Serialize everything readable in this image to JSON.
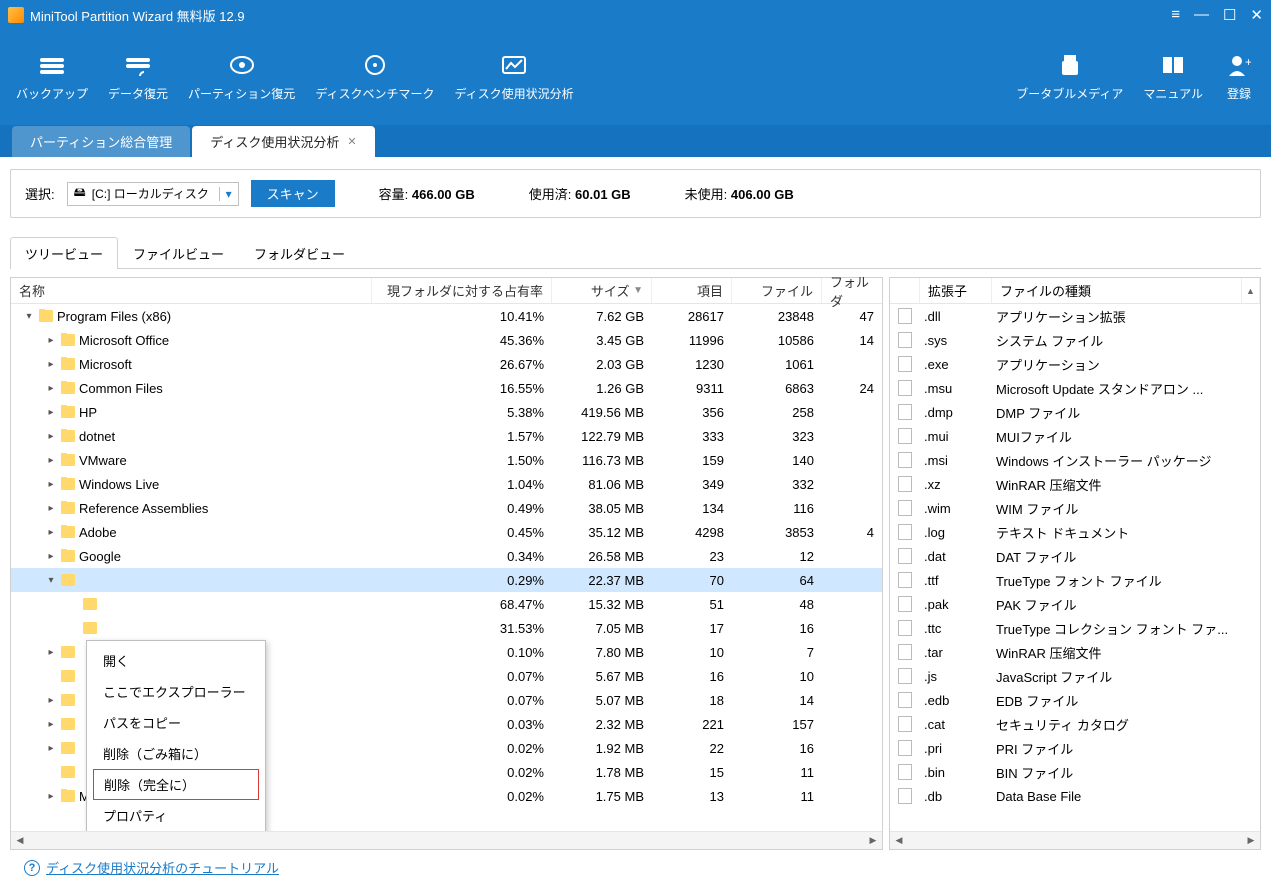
{
  "title": "MiniTool Partition Wizard 無料版 12.9",
  "ribbon": {
    "left": [
      {
        "label": "バックアップ"
      },
      {
        "label": "データ復元"
      },
      {
        "label": "パーティション復元"
      },
      {
        "label": "ディスクベンチマーク"
      },
      {
        "label": "ディスク使用状況分析"
      }
    ],
    "right": [
      {
        "label": "ブータブルメディア"
      },
      {
        "label": "マニュアル"
      },
      {
        "label": "登録"
      }
    ]
  },
  "main_tabs": {
    "inactive": "パーティション総合管理",
    "active": "ディスク使用状況分析"
  },
  "scan": {
    "select_label": "選択:",
    "drive": "[C:] ローカルディスク",
    "scan_btn": "スキャン",
    "cap_label": "容量:",
    "cap_value": "466.00 GB",
    "used_label": "使用済:",
    "used_value": "60.01 GB",
    "free_label": "未使用:",
    "free_value": "406.00 GB"
  },
  "view_tabs": [
    "ツリービュー",
    "ファイルビュー",
    "フォルダビュー"
  ],
  "tree_headers": {
    "name": "名称",
    "ratio": "現フォルダに対する占有率",
    "size": "サイズ",
    "items": "項目",
    "files": "ファイル",
    "folders": "フォルダ"
  },
  "tree_rows": [
    {
      "indent": 0,
      "arrow": "▾",
      "name": "Program Files (x86)",
      "ratio": "10.41%",
      "size": "7.62 GB",
      "items": "28617",
      "files": "23848",
      "folders": "47",
      "sel": false
    },
    {
      "indent": 1,
      "arrow": "▸",
      "name": "Microsoft Office",
      "ratio": "45.36%",
      "size": "3.45 GB",
      "items": "11996",
      "files": "10586",
      "folders": "14",
      "sel": false
    },
    {
      "indent": 1,
      "arrow": "▸",
      "name": "Microsoft",
      "ratio": "26.67%",
      "size": "2.03 GB",
      "items": "1230",
      "files": "1061",
      "folders": "",
      "sel": false
    },
    {
      "indent": 1,
      "arrow": "▸",
      "name": "Common Files",
      "ratio": "16.55%",
      "size": "1.26 GB",
      "items": "9311",
      "files": "6863",
      "folders": "24",
      "sel": false
    },
    {
      "indent": 1,
      "arrow": "▸",
      "name": "HP",
      "ratio": "5.38%",
      "size": "419.56 MB",
      "items": "356",
      "files": "258",
      "folders": "",
      "sel": false
    },
    {
      "indent": 1,
      "arrow": "▸",
      "name": "dotnet",
      "ratio": "1.57%",
      "size": "122.79 MB",
      "items": "333",
      "files": "323",
      "folders": "",
      "sel": false
    },
    {
      "indent": 1,
      "arrow": "▸",
      "name": "VMware",
      "ratio": "1.50%",
      "size": "116.73 MB",
      "items": "159",
      "files": "140",
      "folders": "",
      "sel": false
    },
    {
      "indent": 1,
      "arrow": "▸",
      "name": "Windows Live",
      "ratio": "1.04%",
      "size": "81.06 MB",
      "items": "349",
      "files": "332",
      "folders": "",
      "sel": false
    },
    {
      "indent": 1,
      "arrow": "▸",
      "name": "Reference Assemblies",
      "ratio": "0.49%",
      "size": "38.05 MB",
      "items": "134",
      "files": "116",
      "folders": "",
      "sel": false
    },
    {
      "indent": 1,
      "arrow": "▸",
      "name": "Adobe",
      "ratio": "0.45%",
      "size": "35.12 MB",
      "items": "4298",
      "files": "3853",
      "folders": "4",
      "sel": false
    },
    {
      "indent": 1,
      "arrow": "▸",
      "name": "Google",
      "ratio": "0.34%",
      "size": "26.58 MB",
      "items": "23",
      "files": "12",
      "folders": "",
      "sel": false
    },
    {
      "indent": 1,
      "arrow": "▾",
      "name": "",
      "ratio": "0.29%",
      "size": "22.37 MB",
      "items": "70",
      "files": "64",
      "folders": "",
      "sel": true
    },
    {
      "indent": 2,
      "arrow": "",
      "name": "",
      "ratio": "68.47%",
      "size": "15.32 MB",
      "items": "51",
      "files": "48",
      "folders": "",
      "sel": false
    },
    {
      "indent": 2,
      "arrow": "",
      "name": "",
      "ratio": "31.53%",
      "size": "7.05 MB",
      "items": "17",
      "files": "16",
      "folders": "",
      "sel": false
    },
    {
      "indent": 1,
      "arrow": "▸",
      "name": "",
      "ratio": "0.10%",
      "size": "7.80 MB",
      "items": "10",
      "files": "7",
      "folders": "",
      "sel": false
    },
    {
      "indent": 1,
      "arrow": "",
      "name": "",
      "ratio": "0.07%",
      "size": "5.67 MB",
      "items": "16",
      "files": "10",
      "folders": "",
      "sel": false
    },
    {
      "indent": 1,
      "arrow": "▸",
      "name": "",
      "ratio": "0.07%",
      "size": "5.07 MB",
      "items": "18",
      "files": "14",
      "folders": "",
      "sel": false
    },
    {
      "indent": 1,
      "arrow": "▸",
      "name": "",
      "ratio": "0.03%",
      "size": "2.32 MB",
      "items": "221",
      "files": "157",
      "folders": "",
      "sel": false
    },
    {
      "indent": 1,
      "arrow": "▸",
      "name": "",
      "ratio": "0.02%",
      "size": "1.92 MB",
      "items": "22",
      "files": "16",
      "folders": "",
      "sel": false
    },
    {
      "indent": 1,
      "arrow": "",
      "name": "",
      "ratio": "0.02%",
      "size": "1.78 MB",
      "items": "15",
      "files": "11",
      "folders": "",
      "sel": false
    },
    {
      "indent": 1,
      "arrow": "▸",
      "name": "Microsoft SQL Server Compa...",
      "ratio": "0.02%",
      "size": "1.75 MB",
      "items": "13",
      "files": "11",
      "folders": "",
      "sel": false
    }
  ],
  "ext_headers": {
    "ext": "拡張子",
    "type": "ファイルの種類"
  },
  "ext_rows": [
    {
      "ext": ".dll",
      "type": "アプリケーション拡張"
    },
    {
      "ext": ".sys",
      "type": "システム ファイル"
    },
    {
      "ext": ".exe",
      "type": "アプリケーション"
    },
    {
      "ext": ".msu",
      "type": "Microsoft Update スタンドアロン ..."
    },
    {
      "ext": ".dmp",
      "type": "DMP ファイル"
    },
    {
      "ext": ".mui",
      "type": "MUIファイル"
    },
    {
      "ext": ".msi",
      "type": "Windows インストーラー パッケージ"
    },
    {
      "ext": ".xz",
      "type": "WinRAR 压缩文件"
    },
    {
      "ext": ".wim",
      "type": "WIM ファイル"
    },
    {
      "ext": ".log",
      "type": "テキスト ドキュメント"
    },
    {
      "ext": ".dat",
      "type": "DAT ファイル"
    },
    {
      "ext": ".ttf",
      "type": "TrueType フォント ファイル"
    },
    {
      "ext": ".pak",
      "type": "PAK ファイル"
    },
    {
      "ext": ".ttc",
      "type": "TrueType コレクション フォント ファ..."
    },
    {
      "ext": ".tar",
      "type": "WinRAR 压缩文件"
    },
    {
      "ext": ".js",
      "type": "JavaScript ファイル"
    },
    {
      "ext": ".edb",
      "type": "EDB ファイル"
    },
    {
      "ext": ".cat",
      "type": "セキュリティ カタログ"
    },
    {
      "ext": ".pri",
      "type": "PRI ファイル"
    },
    {
      "ext": ".bin",
      "type": "BIN ファイル"
    },
    {
      "ext": ".db",
      "type": "Data Base File"
    }
  ],
  "context_menu": [
    "開く",
    "ここでエクスプローラー",
    "パスをコピー",
    "削除（ごみ箱に）",
    "削除（完全に）",
    "プロパティ"
  ],
  "context_highlight_index": 4,
  "footer_link": "ディスク使用状況分析のチュートリアル"
}
